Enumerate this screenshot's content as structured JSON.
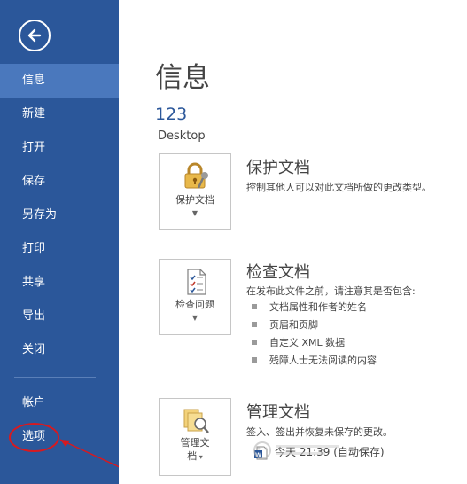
{
  "sidebar": {
    "items": [
      {
        "label": "信息",
        "active": true
      },
      {
        "label": "新建"
      },
      {
        "label": "打开"
      },
      {
        "label": "保存"
      },
      {
        "label": "另存为"
      },
      {
        "label": "打印"
      },
      {
        "label": "共享"
      },
      {
        "label": "导出"
      },
      {
        "label": "关闭"
      }
    ],
    "bottom_items": [
      {
        "label": "帐户"
      },
      {
        "label": "选项"
      }
    ],
    "colors": {
      "background": "#2b579a",
      "active": "#4a78bd"
    }
  },
  "main": {
    "title": "信息",
    "doc_name": "123",
    "doc_location": "Desktop",
    "sections": {
      "protect": {
        "button_label": "保护文档",
        "title": "保护文档",
        "description": "控制其他人可以对此文档所做的更改类型。",
        "icon": "lock-key-icon"
      },
      "inspect": {
        "button_label": "检查问题",
        "title": "检查文档",
        "description": "在发布此文件之前，请注意其是否包含:",
        "bullets": [
          "文档属性和作者的姓名",
          "页眉和页脚",
          "自定义 XML 数据",
          "残障人士无法阅读的内容"
        ],
        "icon": "inspect-document-icon"
      },
      "manage": {
        "button_label_line1": "管理文",
        "button_label_line2": "档",
        "title": "管理文档",
        "description": "签入、签出并恢复未保存的更改。",
        "version_entry": "今天 21:39 (自动保存)",
        "icon": "manage-versions-icon"
      }
    }
  },
  "annotation": {
    "color": "#d8191f"
  }
}
